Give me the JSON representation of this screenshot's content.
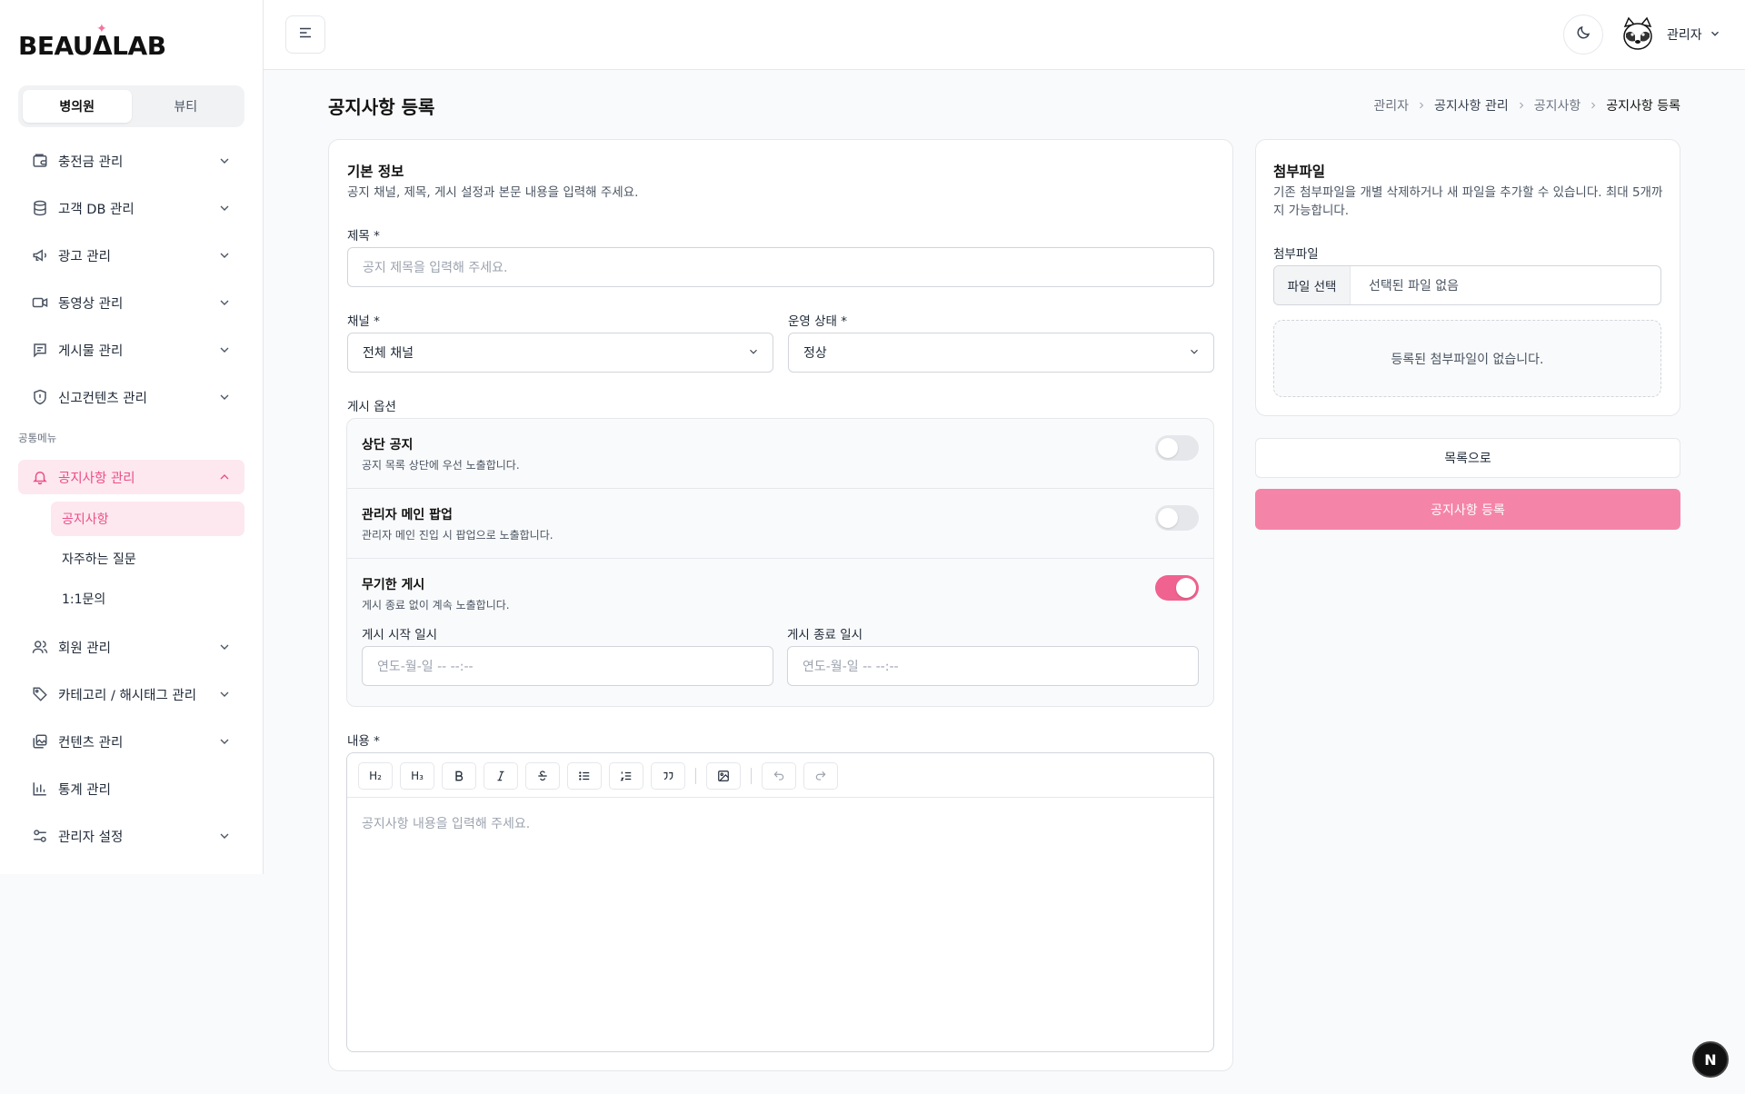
{
  "brand": {
    "logo_text": "BEAUΔLAB"
  },
  "sidebar": {
    "segments": [
      "병의원",
      "뷰티"
    ],
    "items": [
      {
        "label": "충전금 관리",
        "icon": "wallet-icon"
      },
      {
        "label": "고객 DB 관리",
        "icon": "database-icon"
      },
      {
        "label": "광고 관리",
        "icon": "megaphone-icon"
      },
      {
        "label": "동영상 관리",
        "icon": "video-icon"
      },
      {
        "label": "게시물 관리",
        "icon": "post-icon"
      },
      {
        "label": "신고컨텐츠 관리",
        "icon": "shield-alert-icon"
      }
    ],
    "section_label": "공통메뉴",
    "common_items": [
      {
        "label": "공지사항 관리",
        "icon": "bell-icon"
      },
      {
        "label": "회원 관리",
        "icon": "users-icon"
      },
      {
        "label": "카테고리 / 해시태그 관리",
        "icon": "tag-icon"
      },
      {
        "label": "컨텐츠 관리",
        "icon": "images-icon"
      },
      {
        "label": "통계 관리",
        "icon": "bar-chart-icon"
      },
      {
        "label": "관리자 설정",
        "icon": "settings-sliders-icon"
      }
    ],
    "sub_items": [
      "공지사항",
      "자주하는 질문",
      "1:1문의"
    ]
  },
  "header": {
    "user_name": "관리자"
  },
  "page": {
    "title": "공지사항 등록",
    "breadcrumb": [
      "관리자",
      "공지사항 관리",
      "공지사항",
      "공지사항 등록"
    ]
  },
  "basic_info": {
    "title": "기본 정보",
    "description": "공지 채널, 제목, 게시 설정과 본문 내용을 입력해 주세요.",
    "subject_label": "제목 *",
    "subject_placeholder": "공지 제목을 입력해 주세요.",
    "channel_label": "채널 *",
    "channel_value": "전체 채널",
    "status_label": "운영 상태 *",
    "status_value": "정상",
    "options_label": "게시 옵션",
    "options": [
      {
        "title": "상단 공지",
        "desc": "공지 목록 상단에 우선 노출합니다.",
        "on": false
      },
      {
        "title": "관리자 메인 팝업",
        "desc": "관리자 메인 진입 시 팝업으로 노출합니다.",
        "on": false
      },
      {
        "title": "무기한 게시",
        "desc": "게시 종료 없이 계속 노출합니다.",
        "on": true
      }
    ],
    "start_label": "게시 시작 일시",
    "start_placeholder": "연도-월-일 -- --:--",
    "end_label": "게시 종료 일시",
    "end_placeholder": "연도-월-일 -- --:--",
    "content_label": "내용 *",
    "content_placeholder": "공지사항 내용을 입력해 주세요.",
    "toolbar": [
      "H2",
      "H3",
      "B",
      "I",
      "S",
      "bullet-list",
      "ordered-list",
      "quote",
      "image",
      "undo",
      "redo"
    ]
  },
  "attachments": {
    "title": "첨부파일",
    "description": "기존 첨부파일을 개별 삭제하거나 새 파일을 추가할 수 있습니다. 최대 5개까지 가능합니다.",
    "field_label": "첨부파일",
    "choose_label": "파일 선택",
    "no_file": "선택된 파일 없음",
    "empty_text": "등록된 첨부파일이 없습니다."
  },
  "actions": {
    "list_label": "목록으로",
    "submit_label": "공지사항 등록"
  },
  "colors": {
    "accent": "#f0628f",
    "accent_soft": "#fde8ef",
    "submit": "#f585a8"
  }
}
